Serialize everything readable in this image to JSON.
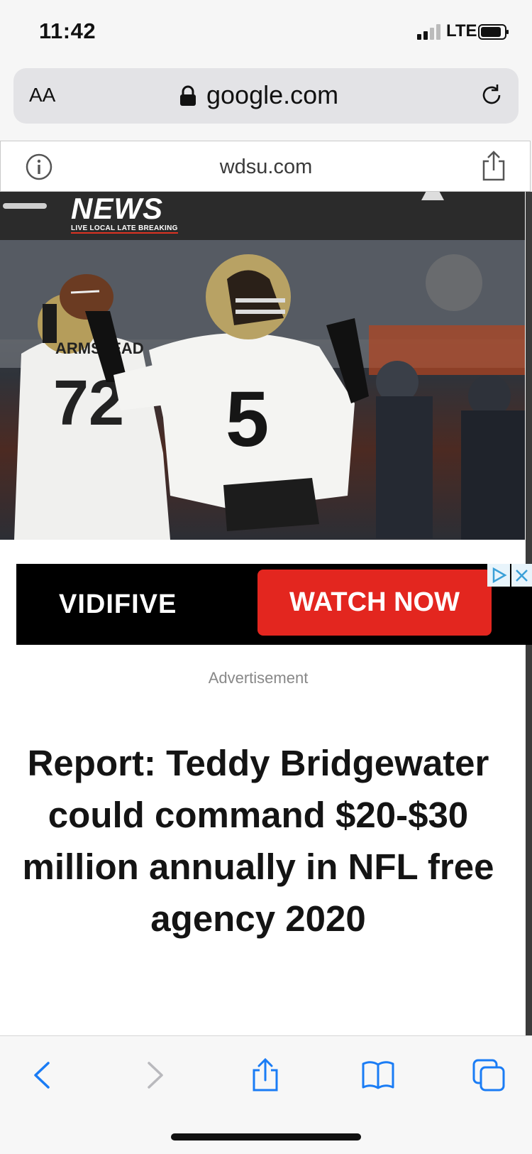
{
  "status_bar": {
    "time": "11:42",
    "network": "LTE"
  },
  "address_bar": {
    "text_size_label": "AA",
    "domain": "google.com"
  },
  "amp_bar": {
    "host": "wdsu.com"
  },
  "site_header": {
    "logo_text": "NEWS",
    "tagline": "LIVE LOCAL LATE BREAKING"
  },
  "ad": {
    "brand": "VIDIFIVE",
    "cta": "WATCH NOW",
    "label": "Advertisement"
  },
  "article": {
    "headline": "Report: Teddy Bridgewater could command $20-$30 million annually in NFL free agency 2020"
  },
  "hero_photo": {
    "jersey_number": "5",
    "teammate_name": "ARMSTEAD",
    "teammate_number": "72"
  },
  "toolbar": {
    "items": [
      "back",
      "forward",
      "share",
      "bookmarks",
      "tabs"
    ]
  },
  "colors": {
    "accent": "#1a7cf5",
    "ad_red": "#e3261f",
    "header_dark": "#2b2b2b"
  }
}
